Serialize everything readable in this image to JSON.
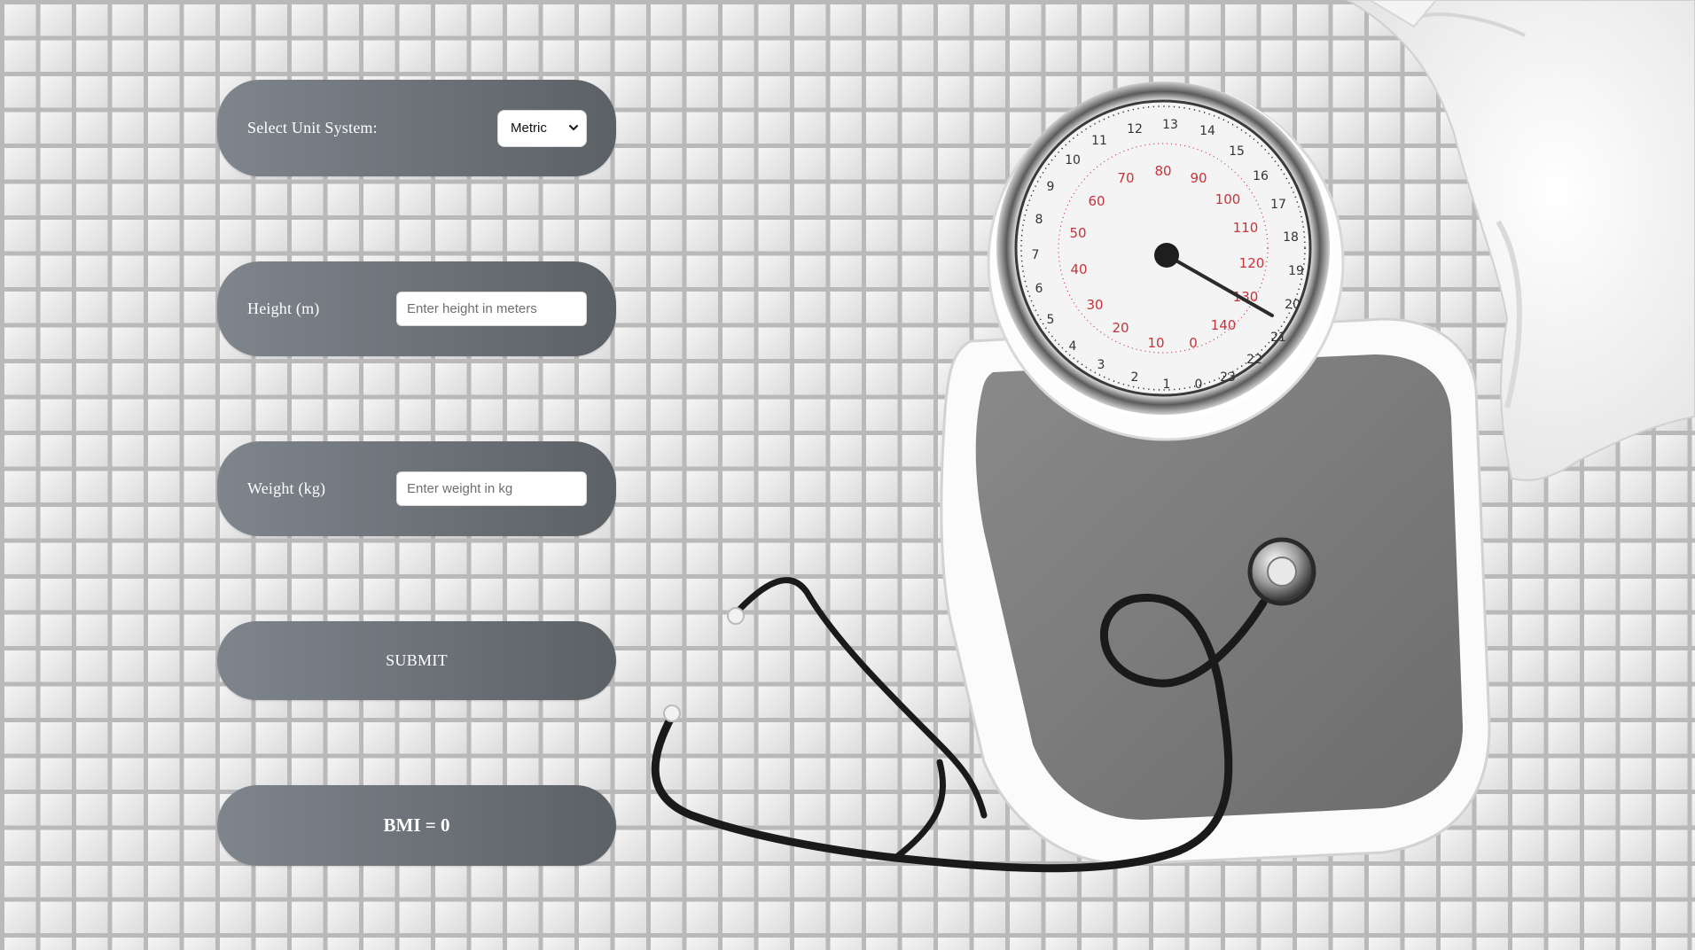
{
  "form": {
    "unit": {
      "label": "Select Unit System:",
      "selected": "Metric"
    },
    "height": {
      "label": "Height (m)",
      "placeholder": "Enter height in meters",
      "value": ""
    },
    "weight": {
      "label": "Weight (kg)",
      "placeholder": "Enter weight in kg",
      "value": ""
    },
    "submit_label": "SUBMIT",
    "result": "BMI = 0"
  },
  "icons": {
    "select_chevron": "chevron-down-icon"
  },
  "colors": {
    "panel_start": "#7f858c",
    "panel_end": "#5c6166",
    "panel_text": "#ffffff",
    "dial_red": "#c8323a"
  }
}
